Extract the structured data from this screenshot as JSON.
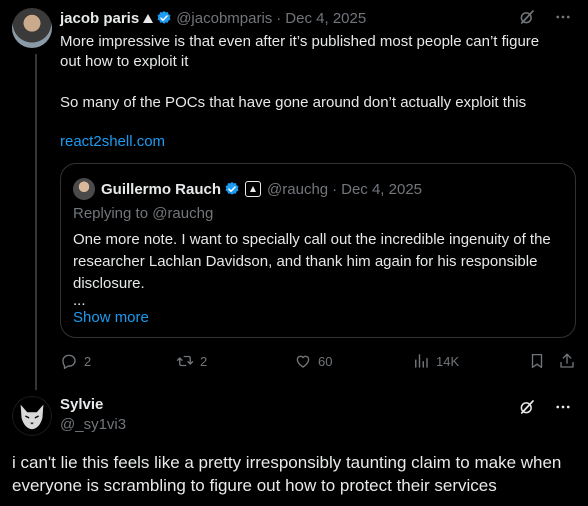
{
  "post1": {
    "author_name": "jacob paris",
    "author_handle": "@jacobmparis",
    "separator": "·",
    "date": "Dec 4, 2025",
    "text_line1": "More impressive is that even after it’s published most people can’t figure",
    "text_line2": "out how to exploit it",
    "text_line3": "So many of the POCs that have gone around don’t actually exploit this",
    "link": "react2shell.com",
    "quote": {
      "author_name": "Guillermo Rauch",
      "author_handle": "@rauchg",
      "separator": "·",
      "date": "Dec 4, 2025",
      "replying_to": "Replying to @rauchg",
      "text": "One more note. I want to specially call out the incredible ingenuity of the researcher Lachlan Davidson, and thank him again for his responsible disclosure.",
      "ellipsis": "...",
      "show_more": "Show more"
    },
    "actions": {
      "replies": "2",
      "reposts": "2",
      "likes": "60",
      "views": "14K"
    }
  },
  "post2": {
    "author_name": "Sylvie",
    "author_handle": "@_sy1vi3",
    "text": "i can't lie this feels like a pretty irresponsibly taunting claim to make when everyone is scrambling to figure out how to protect their services"
  },
  "colors": {
    "background": "#000000",
    "text": "#e7e9ea",
    "muted": "#71767b",
    "link": "#1d9bf0",
    "verified": "#1d9bf0",
    "border": "#2f3336"
  },
  "icons": [
    "verified-badge-icon",
    "affiliate-badge-icon",
    "grok-icon",
    "more-icon",
    "reply-icon",
    "repost-icon",
    "like-icon",
    "views-icon",
    "bookmark-icon",
    "share-icon"
  ]
}
